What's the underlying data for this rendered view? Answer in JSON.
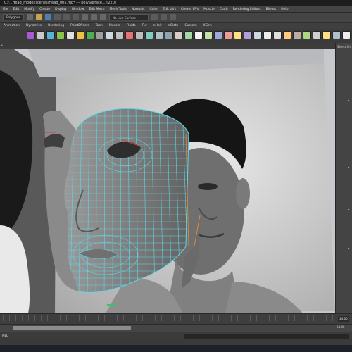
{
  "window": {
    "title": "C:/...Head_model/scenes/Head_005.mb* --- polySurface1.f[220]"
  },
  "menus": [
    "File",
    "Edit",
    "Modify",
    "Create",
    "Display",
    "Window",
    "Edit Mesh",
    "Mesh Tools",
    "Normals",
    "Color",
    "Edit UVs",
    "Create UVs",
    "Muscle",
    "Cloth",
    "Rendering Editors",
    "Bifrost",
    "Help"
  ],
  "status_line": {
    "mode": "Polygons",
    "field_label": "No Live Surface"
  },
  "shelf_tabs": [
    "Animation",
    "Dynamics",
    "Rendering",
    "PaintEffects",
    "Toon",
    "Muscle",
    "Fluids",
    "Fur",
    "nHair",
    "nCloth",
    "Custom",
    "XGen"
  ],
  "shelf_icon_colors": [
    "#a85bd0",
    "#c9c9c9",
    "#59b4d4",
    "#8bc34a",
    "#e0e0e0",
    "#f0c040",
    "#4caf50",
    "#9e9e9e",
    "#cfd8dc",
    "#c0c0c0",
    "#e57373",
    "#bdbdbd",
    "#80cbc4",
    "#b0bec5",
    "#90a4ae",
    "#d7ccc8",
    "#a5d6a7",
    "#f5f5f5",
    "#c5e1a5",
    "#9fa8da",
    "#ef9a9a",
    "#ffe082",
    "#b39ddb",
    "#cfd8dc",
    "#eeeeee",
    "#e0e0e0",
    "#ffcc80",
    "#bcaaa4",
    "#aed581",
    "#d0d0d0",
    "#ffe082",
    "#b0bec5",
    "#eeeeee"
  ],
  "channel_box": {
    "title": "Select Ch"
  },
  "time_slider": {
    "current_frame": "24.00"
  },
  "range_slider": {
    "end_value": "24.00"
  },
  "command_line": {
    "label": "MEL"
  },
  "colors": {
    "wireframe": "#5fd8e8",
    "mesh": "#7d7d7d",
    "viewport_bg": "#cbcdd0"
  }
}
